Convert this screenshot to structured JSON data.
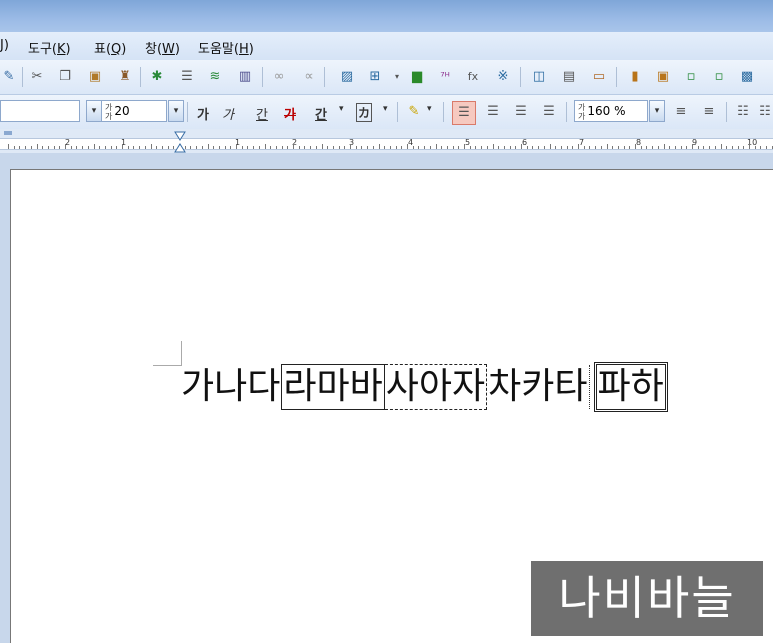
{
  "menu": {
    "items": [
      {
        "label": "J)",
        "hotkey": ""
      },
      {
        "label": "도구(",
        "hotkey": "K",
        "suffix": ")"
      },
      {
        "label": "표(",
        "hotkey": "Q",
        "suffix": ")"
      },
      {
        "label": "창(",
        "hotkey": "W",
        "suffix": ")"
      },
      {
        "label": "도움말(",
        "hotkey": "H",
        "suffix": ")"
      }
    ]
  },
  "toolbar2": {
    "font_size_value": "20",
    "line_spacing_value": "160 %",
    "format_buttons": [
      "가",
      "가",
      "간",
      "가",
      "간",
      "カ"
    ]
  },
  "ruler": {
    "numbers": [
      "2",
      "1",
      "1",
      "2",
      "3",
      "4",
      "5",
      "6",
      "7",
      "8",
      "9",
      "10"
    ]
  },
  "document": {
    "plain_text": "가나다",
    "segments": [
      "라마바",
      "사아자",
      "차카타",
      "파하"
    ]
  },
  "watermark": {
    "text": "나비바늘"
  },
  "colors": {
    "accent": "#7fa6d8",
    "toolbar": "#dbe7f7",
    "page": "#ffffff",
    "watermark_bg": "#6f6f6f"
  }
}
